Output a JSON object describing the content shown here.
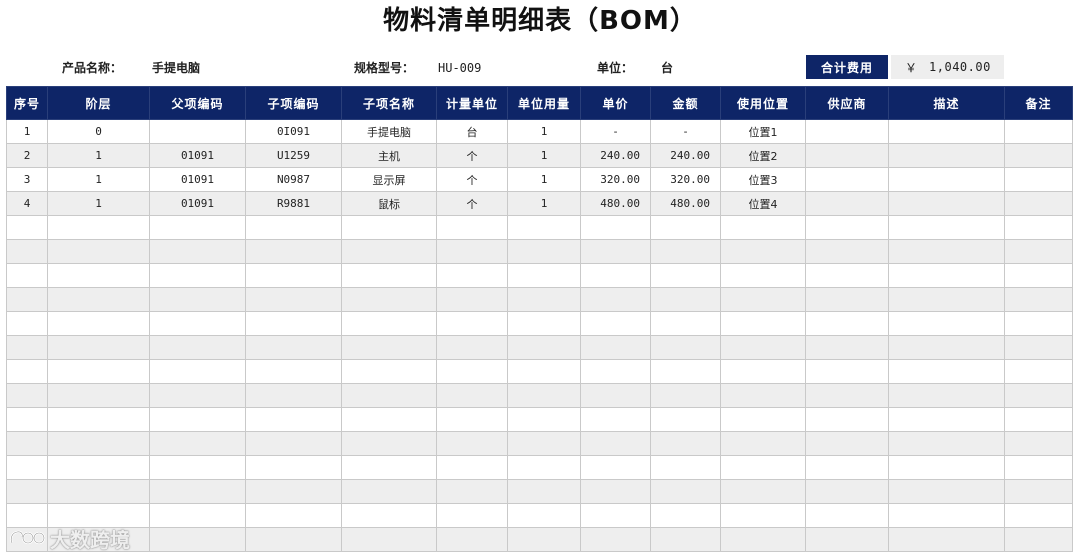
{
  "title": "物料清单明细表（BOM）",
  "info": {
    "product_label": "产品名称：",
    "product_value": "手提电脑",
    "spec_label": "规格型号：",
    "spec_value": "HU-009",
    "unit_label": "单位：",
    "unit_value": "台",
    "total_label": "合计费用",
    "total_currency": "￥",
    "total_value": "1,040.00"
  },
  "columns": [
    "序号",
    "阶层",
    "父项编码",
    "子项编码",
    "子项名称",
    "计量单位",
    "单位用量",
    "单价",
    "金额",
    "使用位置",
    "供应商",
    "描述",
    "备注"
  ],
  "rows": [
    [
      "1",
      "0",
      "",
      "0I091",
      "手提电脑",
      "台",
      "1",
      "-",
      "-",
      "位置1",
      "",
      "",
      ""
    ],
    [
      "2",
      "1",
      "01091",
      "U1259",
      "主机",
      "个",
      "1",
      "240.00",
      "240.00",
      "位置2",
      "",
      "",
      ""
    ],
    [
      "3",
      "1",
      "01091",
      "N0987",
      "显示屏",
      "个",
      "1",
      "320.00",
      "320.00",
      "位置3",
      "",
      "",
      ""
    ],
    [
      "4",
      "1",
      "01091",
      "R9881",
      "鼠标",
      "个",
      "1",
      "480.00",
      "480.00",
      "位置4",
      "",
      "",
      ""
    ]
  ],
  "empty_row_count": 14,
  "watermark": "大数跨境",
  "colors": {
    "header_bg": "#0e2567",
    "stripe": "#eeeeee"
  }
}
